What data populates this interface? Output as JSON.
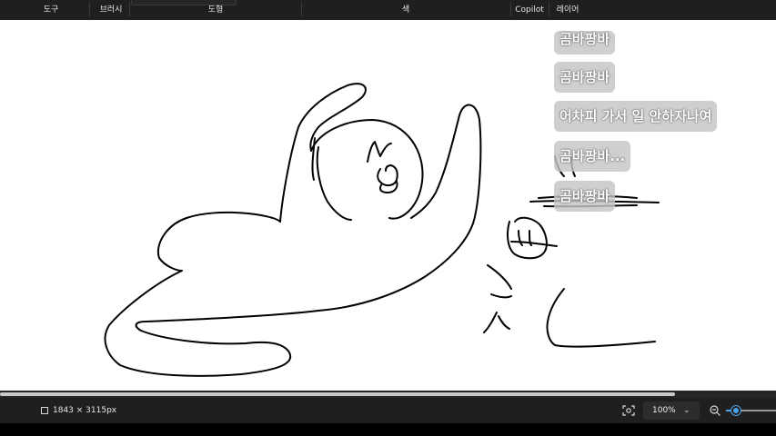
{
  "ribbon": {
    "groups": [
      "도구",
      "브러시",
      "도형",
      "색",
      "Copilot",
      "레이어"
    ]
  },
  "copilot": {
    "suggestions": [
      "곰바팡바",
      "곰바팡바",
      "어차피 가서 일 안하자나여",
      "곰바팡바...",
      "곰바팡바"
    ]
  },
  "status": {
    "dimensions": "1843 × 3115px",
    "zoom": "100%",
    "zoom_caret": "⌄"
  },
  "scrollbar": {
    "position": 0.87
  },
  "zoom_slider": {
    "value": 0.2
  },
  "colors": {
    "chrome": "#1f1f1f",
    "canvas": "#ffffff",
    "ink": "#000000",
    "accent": "#4aa3e8",
    "bubble": "#c4c4c4"
  },
  "icons": [
    "image-dimensions-icon",
    "fit-to-window-icon",
    "zoom-out-icon"
  ]
}
